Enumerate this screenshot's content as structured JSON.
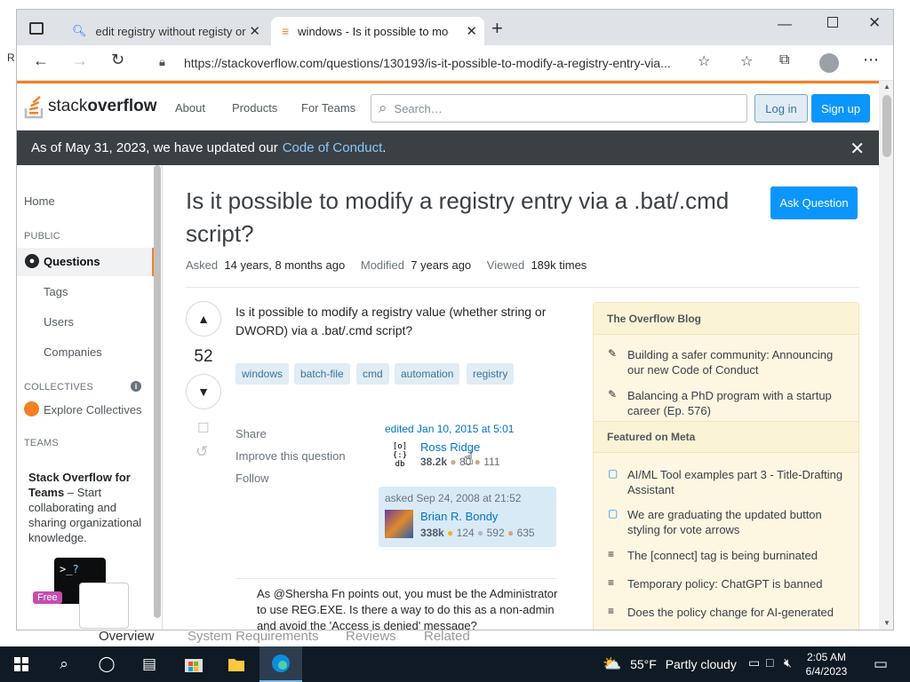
{
  "desktop": {
    "edge_letter": "R",
    "below_window_tabs": [
      "Overview",
      "System Requirements",
      "Reviews",
      "Related"
    ]
  },
  "browser": {
    "tabs": [
      {
        "title": "edit registry without registy or c",
        "icon": "search-icon"
      },
      {
        "title": "windows - Is it possible to modif",
        "icon": "stackoverflow-icon"
      }
    ],
    "new_tab": "+",
    "url": "https://stackoverflow.com/questions/130193/is-it-possible-to-modify-a-registry-entry-via..."
  },
  "so": {
    "logo_light": "stack",
    "logo_bold": "overflow",
    "nav": [
      "About",
      "Products",
      "For Teams"
    ],
    "search_placeholder": "Search…",
    "login": "Log in",
    "signup": "Sign up",
    "banner_text": "As of May 31, 2023, we have updated our",
    "banner_link": "Code of Conduct",
    "banner_end": ".",
    "left": {
      "home": "Home",
      "public": "PUBLIC",
      "questions": "Questions",
      "tags": "Tags",
      "users": "Users",
      "companies": "Companies",
      "collectives": "COLLECTIVES",
      "explore": "Explore Collectives",
      "teams": "TEAMS",
      "teams_title": "Stack Overflow for Teams",
      "teams_text": " – Start collaborating and sharing organizational knowledge.",
      "free": "Free"
    },
    "question": {
      "title": "Is it possible to modify a registry entry via a .bat/.cmd script?",
      "ask_button": "Ask Question",
      "asked_label": "Asked",
      "asked_value": "14 years, 8 months ago",
      "modified_label": "Modified",
      "modified_value": "7 years ago",
      "viewed_label": "Viewed",
      "viewed_value": "189k times",
      "score": "52",
      "body": "Is it possible to modify a registry value (whether string or DWORD) via a .bat/.cmd script?",
      "tags": [
        "windows",
        "batch-file",
        "cmd",
        "automation",
        "registry"
      ],
      "actions": [
        "Share",
        "Improve this question",
        "Follow"
      ],
      "edited": "edited Jan 10, 2015 at 5:01",
      "editor_name": "Ross Ridge",
      "editor_rep": "38.2k",
      "editor_silver": "80",
      "editor_bronze": "111",
      "asked_line": "asked Sep 24, 2008 at 21:52",
      "asker_name": "Brian R. Bondy",
      "asker_rep": "338k",
      "asker_gold": "124",
      "asker_silver": "592",
      "asker_bronze": "635",
      "comment": "As @Shersha Fn points out, you must be the Administrator to use REG.EXE. Is there a way to do this as a non-admin and avoid the 'Access is denied' message?"
    },
    "sidebar": {
      "blog_header": "The Overflow Blog",
      "blog": [
        "Building a safer community: Announcing our new Code of Conduct",
        "Balancing a PhD program with a startup career (Ep. 576)"
      ],
      "meta_header": "Featured on Meta",
      "meta": [
        "AI/ML Tool examples part 3 - Title-Drafting Assistant",
        "We are graduating the updated button styling for vote arrows",
        "The [connect] tag is being burninated",
        "Temporary policy: ChatGPT is banned",
        "Does the policy change for AI-generated"
      ]
    }
  },
  "taskbar": {
    "weather_temp": "55°F",
    "weather_text": "Partly cloudy",
    "time": "2:05 AM",
    "date": "6/4/2023"
  },
  "colors": {
    "accent": "#f48024",
    "primary": "#0a95ff",
    "banner": "#3b4045",
    "taskbar": "#101a24"
  }
}
